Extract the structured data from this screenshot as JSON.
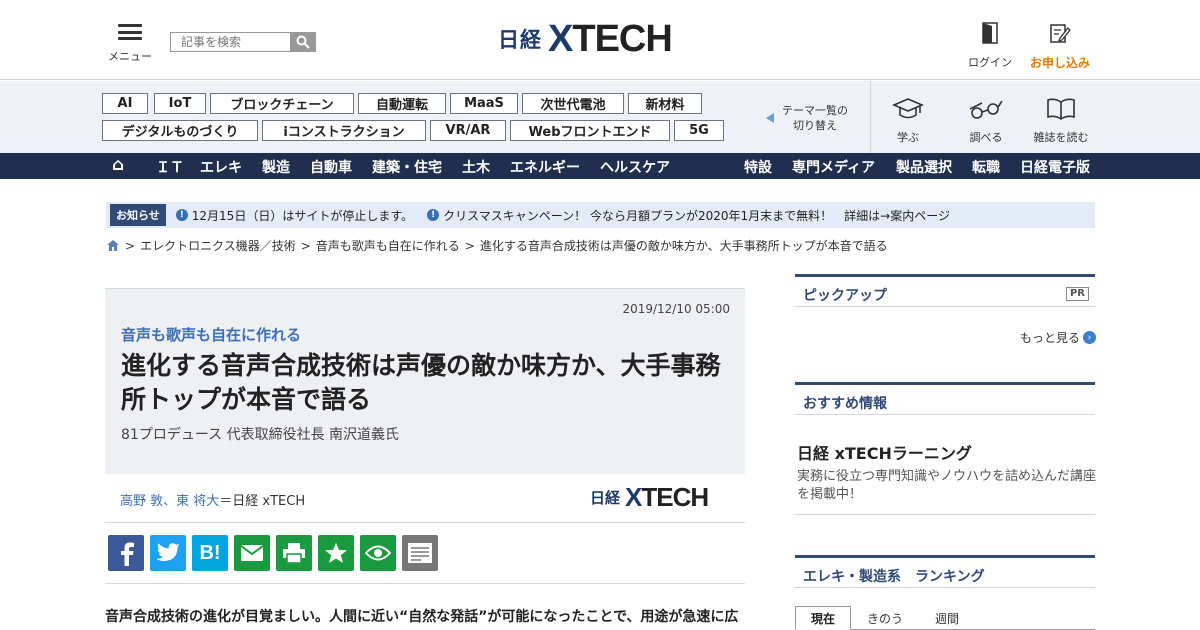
{
  "header": {
    "menu_label": "メニュー",
    "search_placeholder": "記事を検索",
    "logo_nikkei": "日経",
    "logo_x": "X",
    "logo_tech": "TECH",
    "login_label": "ログイン",
    "apply_label": "お申し込み"
  },
  "themes": [
    "AI",
    "IoT",
    "ブロックチェーン",
    "自動運転",
    "MaaS",
    "次世代電池",
    "新材料",
    "デジタルものづくり",
    "iコンストラクション",
    "VR/AR",
    "Webフロントエンド",
    "5G"
  ],
  "theme_switch": {
    "line1": "テーマ一覧の",
    "line2": "切り替え"
  },
  "tools": {
    "learn": "学ぶ",
    "research": "調べる",
    "magazine": "雑誌を読む"
  },
  "nav": {
    "home": "⌂",
    "left": [
      "ＩＴ",
      "エレキ",
      "製造",
      "自動車",
      "建築・住宅",
      "土木",
      "エネルギー",
      "ヘルスケア"
    ],
    "right": [
      "特設",
      "専門メディア",
      "製品選択",
      "転職",
      "日経電子版"
    ]
  },
  "notice": {
    "badge": "お知らせ",
    "items": [
      "12月15日（日）はサイトが停止します。",
      "クリスマスキャンペーン！ 今なら月額プランが2020年1月末まで無料！　詳細は→案内ページ"
    ]
  },
  "breadcrumb": [
    "エレクトロニクス機器／技術",
    "音声も歌声も自在に作れる",
    "進化する音声合成技術は声優の敵か味方か、大手事務所トップが本音で語る"
  ],
  "article": {
    "date": "2019/12/10 05:00",
    "series": "音声も歌声も自在に作れる",
    "title": "進化する音声合成技術は声優の敵か味方か、大手事務所トップが本音で語る",
    "subtitle": "81プロデュース 代表取締役社長 南沢道義氏",
    "authors": "高野 敦、東 将大",
    "authors_suffix": "＝日経 xTECH",
    "lead": "音声合成技術の進化が目覚ましい。人間に近い“自然な発話”が可能になったことで、用途が急速に広"
  },
  "share_colors": {
    "facebook": "#3b5998",
    "twitter": "#1da1f2",
    "hatena": "#00a4de",
    "mail": "#1a9a3e",
    "print": "#1a9a3e",
    "star": "#1a9a3e",
    "eye": "#1a9a3e",
    "memo": "#777777"
  },
  "sidebar": {
    "pickup": "ピックアップ",
    "pr": "PR",
    "more": "もっと見る",
    "recommend": "おすすめ情報",
    "learning_title": "日経 xTECHラーニング",
    "learning_desc": "実務に役立つ専門知識やノウハウを詰め込んだ講座を掲載中！",
    "ranking": "エレキ・製造系　ランキング",
    "tabs": [
      "現在",
      "きのう",
      "週間"
    ]
  }
}
